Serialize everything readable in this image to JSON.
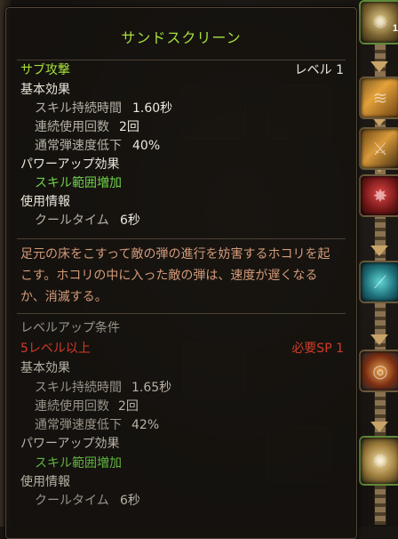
{
  "tooltip": {
    "title": "サンドスクリーン",
    "type": "サブ攻撃",
    "level": "レベル 1",
    "current": {
      "basic_header": "基本効果",
      "stats": [
        {
          "label": "スキル持続時間",
          "value": "1.60秒"
        },
        {
          "label": "連続使用回数",
          "value": "2回"
        },
        {
          "label": "通常弾速度低下",
          "value": "40%"
        }
      ],
      "powerup_header": "パワーアップ効果",
      "powerup_item": "スキル範囲増加",
      "usage_header": "使用情報",
      "cooldown_label": "クールタイム",
      "cooldown_value": "6秒"
    },
    "description": "足元の床をこすって敵の弾の進行を妨害するホコリを起こす。ホコリの中に入った敵の弾は、速度が遅くなるか、消滅する。",
    "levelup": {
      "header": "レベルアップ条件",
      "requirement": "5レベル以上",
      "sp": "必要SP 1",
      "basic_header": "基本効果",
      "stats": [
        {
          "label": "スキル持続時間",
          "value": "1.65秒"
        },
        {
          "label": "連続使用回数",
          "value": "2回"
        },
        {
          "label": "通常弾速度低下",
          "value": "42%"
        }
      ],
      "powerup_header": "パワーアップ効果",
      "powerup_item": "スキル範囲増加",
      "usage_header": "使用情報",
      "cooldown_label": "クールタイム",
      "cooldown_value": "6秒"
    }
  },
  "skill_tree": {
    "top_node_level": "1"
  },
  "colors": {
    "title": "#a8e03a",
    "green_text": "#6fd04a",
    "requirement_red": "#d23a2a",
    "description": "#d49a79"
  }
}
